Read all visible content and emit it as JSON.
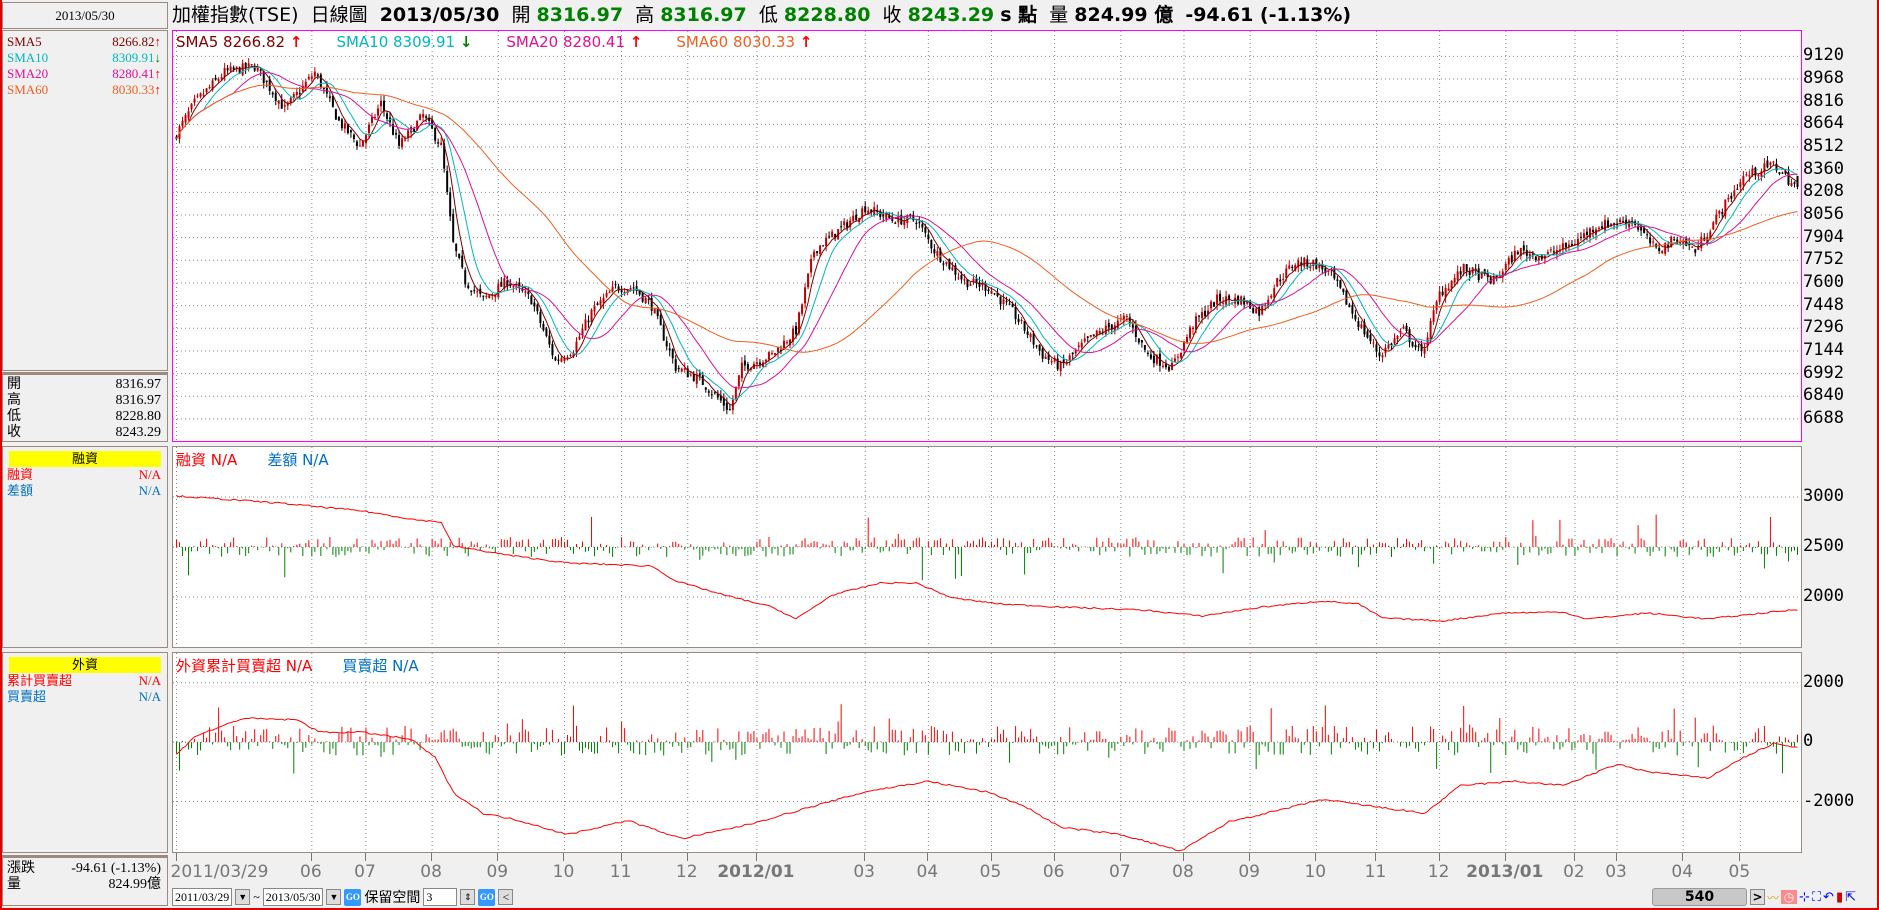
{
  "header": {
    "title": "加權指數(TSE)",
    "chart_type": "日線圖",
    "date": "2013/05/30",
    "open_label": "開",
    "open": "8316.97",
    "high_label": "高",
    "high": "8316.97",
    "low_label": "低",
    "low": "8228.80",
    "close_label": "收",
    "close": "8243.29",
    "unit_label": "s 點",
    "volume_label": "量",
    "volume": "824.99 億",
    "change": "-94.61 (-1.13%)"
  },
  "left": {
    "date": "2013/05/30",
    "sma": [
      {
        "name": "SMA5",
        "value": "8266.82",
        "arrow": "↑",
        "color": "#800000"
      },
      {
        "name": "SMA10",
        "value": "8309.91",
        "arrow": "↓",
        "color": "#00b8c0"
      },
      {
        "name": "SMA20",
        "value": "8280.41",
        "arrow": "↑",
        "color": "#e0109a"
      },
      {
        "name": "SMA60",
        "value": "8030.33",
        "arrow": "↑",
        "color": "#f06020"
      }
    ],
    "ohlc": [
      {
        "label": "開",
        "value": "8316.97"
      },
      {
        "label": "高",
        "value": "8316.97"
      },
      {
        "label": "低",
        "value": "8228.80"
      },
      {
        "label": "收",
        "value": "8243.29"
      }
    ],
    "margin": {
      "title": "融資",
      "rows": [
        {
          "label": "融資",
          "value": "N/A"
        },
        {
          "label": "差額",
          "value": "N/A"
        }
      ]
    },
    "foreign": {
      "title": "外資",
      "rows": [
        {
          "label": "累計買賣超",
          "value": "N/A"
        },
        {
          "label": "買賣超",
          "value": "N/A"
        }
      ]
    },
    "bottom": [
      {
        "label": "漲跌",
        "value": "-94.61 (-1.13%)"
      },
      {
        "label": "量",
        "value": "824.99億"
      }
    ]
  },
  "panels": {
    "price_legend": [
      {
        "text": "SMA5 8266.82",
        "arrow": "↑"
      },
      {
        "text": "SMA10 8309.91",
        "arrow": "↓"
      },
      {
        "text": "SMA20 8280.41",
        "arrow": "↑"
      },
      {
        "text": "SMA60 8030.33",
        "arrow": "↑"
      }
    ],
    "margin_legend": [
      {
        "text": "融資 N/A"
      },
      {
        "text": "差額 N/A"
      }
    ],
    "foreign_legend": [
      {
        "text": "外資累計買賣超 N/A"
      },
      {
        "text": "買賣超 N/A"
      }
    ]
  },
  "toolbar": {
    "start_date": "2011/03/29",
    "tilde": "~",
    "end_date": "2013/05/30",
    "go": "GO",
    "reserve_label": "保留空間",
    "reserve_value": "3",
    "prev": "<",
    "count": "540",
    "next": ">"
  },
  "chart_data": {
    "type": "candlestick",
    "days": 540,
    "price_axis": {
      "ticks": [
        9120,
        8968,
        8816,
        8664,
        8512,
        8360,
        8208,
        8056,
        7904,
        7752,
        7600,
        7448,
        7296,
        7144,
        6992,
        6840,
        6688
      ],
      "range": [
        6540,
        9290
      ]
    },
    "x_ticks": [
      {
        "i": 0,
        "label": "2011/03/29",
        "bold": false
      },
      {
        "i": 45,
        "label": "06"
      },
      {
        "i": 63,
        "label": "07"
      },
      {
        "i": 85,
        "label": "08"
      },
      {
        "i": 107,
        "label": "09"
      },
      {
        "i": 129,
        "label": "10"
      },
      {
        "i": 148,
        "label": "11"
      },
      {
        "i": 170,
        "label": "12"
      },
      {
        "i": 193,
        "label": "2012/01",
        "bold": true
      },
      {
        "i": 229,
        "label": "03"
      },
      {
        "i": 250,
        "label": "04"
      },
      {
        "i": 271,
        "label": "05"
      },
      {
        "i": 292,
        "label": "06"
      },
      {
        "i": 314,
        "label": "07"
      },
      {
        "i": 335,
        "label": "08"
      },
      {
        "i": 357,
        "label": "09"
      },
      {
        "i": 379,
        "label": "10"
      },
      {
        "i": 399,
        "label": "11"
      },
      {
        "i": 420,
        "label": "12"
      },
      {
        "i": 442,
        "label": "2013/01",
        "bold": true
      },
      {
        "i": 465,
        "label": "02"
      },
      {
        "i": 479,
        "label": "03"
      },
      {
        "i": 501,
        "label": "04"
      },
      {
        "i": 520,
        "label": "05"
      }
    ],
    "close_anchors": [
      [
        0,
        8600
      ],
      [
        6,
        8807
      ],
      [
        16,
        9013
      ],
      [
        26,
        9054
      ],
      [
        36,
        8766
      ],
      [
        46,
        9013
      ],
      [
        54,
        8683
      ],
      [
        61,
        8518
      ],
      [
        68,
        8807
      ],
      [
        74,
        8518
      ],
      [
        82,
        8724
      ],
      [
        88,
        8518
      ],
      [
        92,
        7860
      ],
      [
        96,
        7612
      ],
      [
        102,
        7488
      ],
      [
        110,
        7612
      ],
      [
        118,
        7488
      ],
      [
        126,
        7076
      ],
      [
        132,
        7158
      ],
      [
        138,
        7405
      ],
      [
        146,
        7570
      ],
      [
        152,
        7570
      ],
      [
        158,
        7447
      ],
      [
        166,
        7035
      ],
      [
        174,
        6952
      ],
      [
        184,
        6746
      ],
      [
        188,
        7035
      ],
      [
        198,
        7117
      ],
      [
        206,
        7282
      ],
      [
        212,
        7818
      ],
      [
        222,
        7982
      ],
      [
        229,
        8106
      ],
      [
        238,
        8024
      ],
      [
        246,
        8024
      ],
      [
        252,
        7818
      ],
      [
        262,
        7612
      ],
      [
        270,
        7570
      ],
      [
        278,
        7405
      ],
      [
        288,
        7117
      ],
      [
        294,
        7035
      ],
      [
        302,
        7200
      ],
      [
        308,
        7282
      ],
      [
        316,
        7364
      ],
      [
        323,
        7117
      ],
      [
        331,
        7035
      ],
      [
        338,
        7323
      ],
      [
        346,
        7488
      ],
      [
        354,
        7488
      ],
      [
        360,
        7405
      ],
      [
        366,
        7612
      ],
      [
        372,
        7735
      ],
      [
        378,
        7735
      ],
      [
        384,
        7653
      ],
      [
        392,
        7364
      ],
      [
        400,
        7117
      ],
      [
        408,
        7282
      ],
      [
        414,
        7117
      ],
      [
        420,
        7529
      ],
      [
        428,
        7694
      ],
      [
        438,
        7612
      ],
      [
        446,
        7818
      ],
      [
        454,
        7776
      ],
      [
        464,
        7860
      ],
      [
        472,
        7982
      ],
      [
        484,
        8024
      ],
      [
        492,
        7818
      ],
      [
        499,
        7900
      ],
      [
        505,
        7818
      ],
      [
        513,
        8065
      ],
      [
        521,
        8312
      ],
      [
        531,
        8394
      ],
      [
        537,
        8271
      ],
      [
        539,
        8243
      ]
    ],
    "margin_axis": {
      "ticks": [
        3000,
        2500,
        2000
      ],
      "range": [
        1500,
        3500
      ]
    },
    "margin_anchors": [
      [
        0,
        3010
      ],
      [
        34,
        2940
      ],
      [
        62,
        2860
      ],
      [
        80,
        2770
      ],
      [
        88,
        2750
      ],
      [
        92,
        2510
      ],
      [
        110,
        2420
      ],
      [
        130,
        2340
      ],
      [
        158,
        2310
      ],
      [
        166,
        2160
      ],
      [
        182,
        2020
      ],
      [
        198,
        1900
      ],
      [
        206,
        1780
      ],
      [
        218,
        2020
      ],
      [
        234,
        2140
      ],
      [
        246,
        2140
      ],
      [
        258,
        1990
      ],
      [
        274,
        1930
      ],
      [
        294,
        1900
      ],
      [
        321,
        1870
      ],
      [
        341,
        1810
      ],
      [
        361,
        1900
      ],
      [
        381,
        1960
      ],
      [
        393,
        1930
      ],
      [
        401,
        1790
      ],
      [
        421,
        1760
      ],
      [
        441,
        1840
      ],
      [
        461,
        1850
      ],
      [
        469,
        1780
      ],
      [
        489,
        1840
      ],
      [
        509,
        1780
      ],
      [
        537,
        1870
      ]
    ],
    "foreign_axis": {
      "ticks": [
        2000,
        0,
        -2000
      ],
      "range": [
        -3700,
        3000
      ]
    },
    "foreign_anchors": [
      [
        0,
        -420
      ],
      [
        6,
        190
      ],
      [
        22,
        800
      ],
      [
        40,
        750
      ],
      [
        48,
        330
      ],
      [
        62,
        330
      ],
      [
        78,
        90
      ],
      [
        86,
        -520
      ],
      [
        92,
        -1690
      ],
      [
        102,
        -2400
      ],
      [
        114,
        -2640
      ],
      [
        130,
        -3110
      ],
      [
        150,
        -2640
      ],
      [
        168,
        -3250
      ],
      [
        190,
        -2780
      ],
      [
        210,
        -2210
      ],
      [
        230,
        -1650
      ],
      [
        250,
        -1320
      ],
      [
        270,
        -1690
      ],
      [
        282,
        -2160
      ],
      [
        294,
        -2870
      ],
      [
        314,
        -3110
      ],
      [
        334,
        -3670
      ],
      [
        350,
        -2680
      ],
      [
        366,
        -2310
      ],
      [
        381,
        -1930
      ],
      [
        401,
        -2210
      ],
      [
        415,
        -2400
      ],
      [
        427,
        -1460
      ],
      [
        445,
        -1320
      ],
      [
        461,
        -1460
      ],
      [
        479,
        -750
      ],
      [
        489,
        -990
      ],
      [
        509,
        -1220
      ],
      [
        521,
        -520
      ],
      [
        531,
        -50
      ],
      [
        539,
        -190
      ]
    ]
  }
}
